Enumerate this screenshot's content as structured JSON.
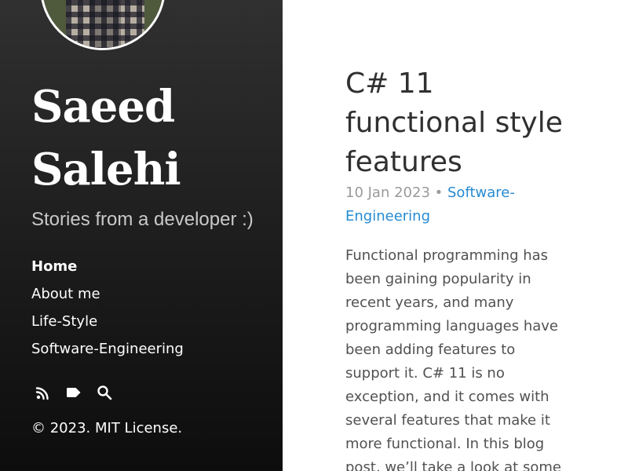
{
  "sidebar": {
    "title_line1": "Saeed",
    "title_line2": "Salehi",
    "tagline": "Stories from a developer :)",
    "nav": [
      {
        "label": "Home"
      },
      {
        "label": "About me"
      },
      {
        "label": "Life-Style"
      },
      {
        "label": "Software-Engineering"
      }
    ],
    "social_icons": [
      "rss-icon",
      "tag-icon",
      "search-icon"
    ],
    "copyright_prefix": "© 2023. ",
    "license": "MIT License."
  },
  "post": {
    "title_lines": [
      "C# 11",
      "functional style",
      "features"
    ],
    "date": "10 Jan 2023",
    "separator": "•",
    "category_line1": "Software-",
    "category_line2": "Engineering",
    "body_lines": [
      "Functional programming has",
      "been gaining popularity in",
      "recent years, and many",
      "programming languages have",
      "been adding features to",
      "support it. C# 11 is no",
      "exception, and it comes with",
      "several features that make it",
      "more functional. In this blog",
      "post, we’ll take a look at some"
    ]
  },
  "colors": {
    "sidebar_bg": "#202020",
    "link": "#268bd2",
    "meta": "#9a9a9a",
    "body_text": "#515151",
    "title_text": "#303030"
  }
}
